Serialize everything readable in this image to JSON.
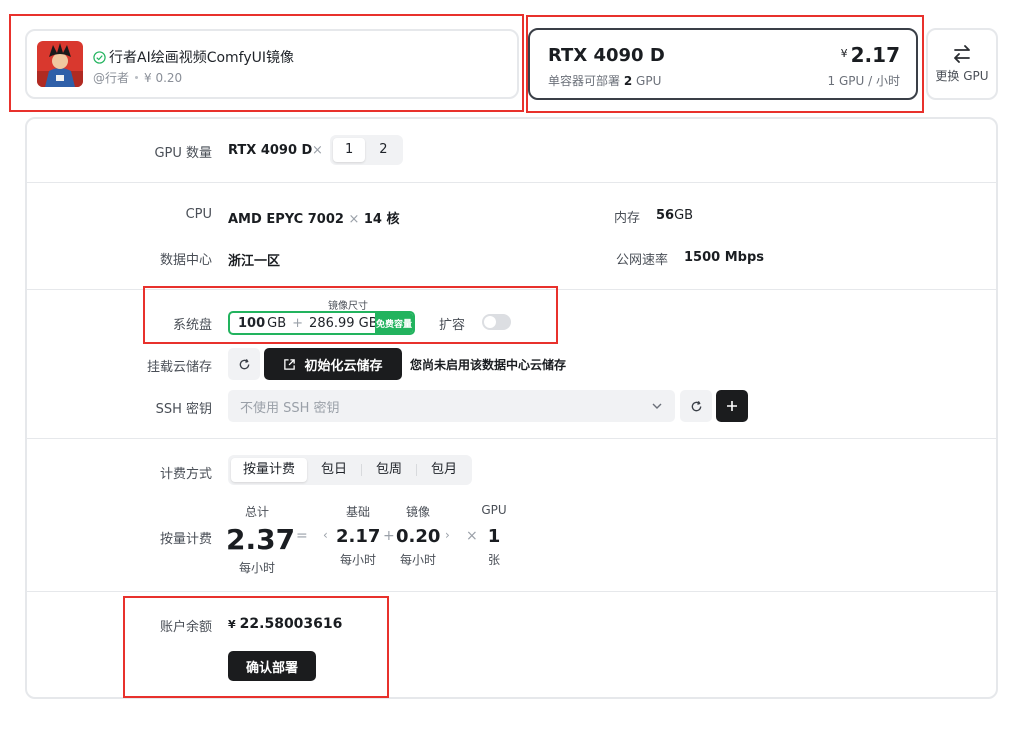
{
  "image_card": {
    "title": "行者AI绘画视频ComfyUI镜像",
    "author": "@行者",
    "price": "¥ 0.20"
  },
  "gpu_card": {
    "name": "RTX 4090 D",
    "sub_prefix": "单容器可部署",
    "sub_count": "2",
    "sub_suffix": "GPU",
    "currency": "¥",
    "price": "2.17",
    "unit": "1 GPU / 小时"
  },
  "change_gpu": {
    "label": "更换 GPU",
    "icon": "swap-icon"
  },
  "gpu_count": {
    "label": "GPU 数量",
    "model": "RTX 4090 D",
    "times": "×",
    "options": [
      "1",
      "2"
    ],
    "selected": "1"
  },
  "specs": {
    "cpu_label": "CPU",
    "cpu_model": "AMD EPYC 7002",
    "cpu_times": "×",
    "cpu_cores": "14",
    "cpu_unit": "核",
    "mem_label": "内存",
    "mem_value": "56",
    "mem_unit": "GB",
    "dc_label": "数据中心",
    "dc_value": "浙江一区",
    "net_label": "公网速率",
    "net_value": "1500 Mbps"
  },
  "disk": {
    "label": "系统盘",
    "caption": "镜像尺寸",
    "base_value": "100",
    "base_unit": "GB",
    "plus": "+",
    "image_size": "286.99 GB",
    "free_tag": "免费容量",
    "expand_label": "扩容",
    "expand_on": false
  },
  "cloud_storage": {
    "label": "挂载云储存",
    "init_button": "初始化云储存",
    "notice": "您尚未启用该数据中心云储存"
  },
  "ssh": {
    "label": "SSH 密钥",
    "placeholder": "不使用 SSH 密钥"
  },
  "billing": {
    "label": "计费方式",
    "options": [
      "按量计费",
      "包日",
      "包周",
      "包月"
    ],
    "selected": "按量计费"
  },
  "pay_as_you_go": {
    "label": "按量计费",
    "total_label": "总计",
    "total_value": "2.37",
    "total_unit": "每小时",
    "equals": "=",
    "base_label": "基础",
    "base_value": "2.17",
    "base_unit": "每小时",
    "plus": "+",
    "image_label": "镜像",
    "image_value": "0.20",
    "image_unit": "每小时",
    "times": "×",
    "gpu_label": "GPU",
    "gpu_value": "1",
    "gpu_unit": "张"
  },
  "balance": {
    "label": "账户余额",
    "currency": "¥",
    "value": "22.58003616",
    "confirm_button": "确认部署"
  },
  "colors": {
    "accent_green": "#22b35e",
    "dark_button": "#1b1c1e",
    "highlight_red": "#e8312c"
  }
}
